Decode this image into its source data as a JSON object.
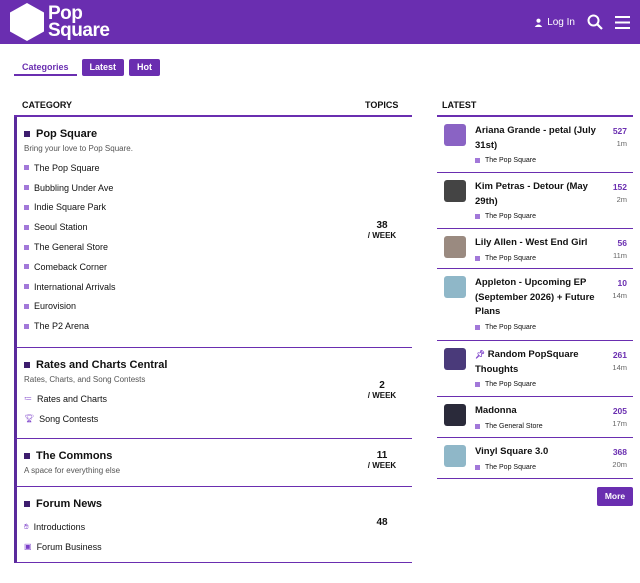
{
  "header": {
    "logo_line1": "Pop",
    "logo_line2": "Square",
    "login_label": "Log In",
    "brand_color": "#6a2eb0"
  },
  "nav": {
    "categories": "Categories",
    "latest": "Latest",
    "hot": "Hot"
  },
  "columns": {
    "category": "CATEGORY",
    "topics": "TOPICS",
    "latest": "LATEST"
  },
  "categories": [
    {
      "title": "Pop Square",
      "desc": "Bring your love to Pop Square.",
      "subs": [
        "The Pop Square",
        "Bubbling Under Ave",
        "Indie Square Park",
        "Seoul Station",
        "The General Store",
        "Comeback Corner",
        "International Arrivals",
        "Eurovision",
        "The P2 Arena"
      ],
      "topics": "38",
      "per": "/ WEEK"
    },
    {
      "title": "Rates and Charts Central",
      "desc": "Rates, Charts, and Song Contests",
      "subs": [
        "Rates and Charts",
        "Song Contests"
      ],
      "topics": "2",
      "per": "/ WEEK"
    },
    {
      "title": "The Commons",
      "desc": "A space for everything else",
      "subs": [],
      "topics": "11",
      "per": "/ WEEK"
    },
    {
      "title": "Forum News",
      "desc": "",
      "subs": [
        "Introductions",
        "Forum Business"
      ],
      "topics": "48",
      "per": ""
    }
  ],
  "latest": [
    {
      "title": "Ariana Grande - petal (July 31st)",
      "category": "The Pop Square",
      "count": "527",
      "time": "1m",
      "avatar_color": "#8a63c4"
    },
    {
      "title": "Kim Petras - Detour (May 29th)",
      "category": "The Pop Square",
      "count": "152",
      "time": "2m",
      "avatar_color": "#444444"
    },
    {
      "title": "Lily Allen - West End Girl",
      "category": "The Pop Square",
      "count": "56",
      "time": "11m",
      "avatar_color": "#9a8a80"
    },
    {
      "title": "Appleton - Upcoming EP (September 2026) + Future Plans",
      "category": "The Pop Square",
      "count": "10",
      "time": "14m",
      "avatar_color": "#8fb7c8"
    },
    {
      "title": "Random PopSquare Thoughts",
      "category": "The Pop Square",
      "count": "261",
      "time": "14m",
      "avatar_color": "#4a3a7a"
    },
    {
      "title": "Madonna",
      "category": "The General Store",
      "count": "205",
      "time": "17m",
      "avatar_color": "#2a2a3a"
    },
    {
      "title": "Vinyl Square 3.0",
      "category": "The Pop Square",
      "count": "368",
      "time": "20m",
      "avatar_color": "#8fb7c8"
    }
  ],
  "more_label": "More"
}
